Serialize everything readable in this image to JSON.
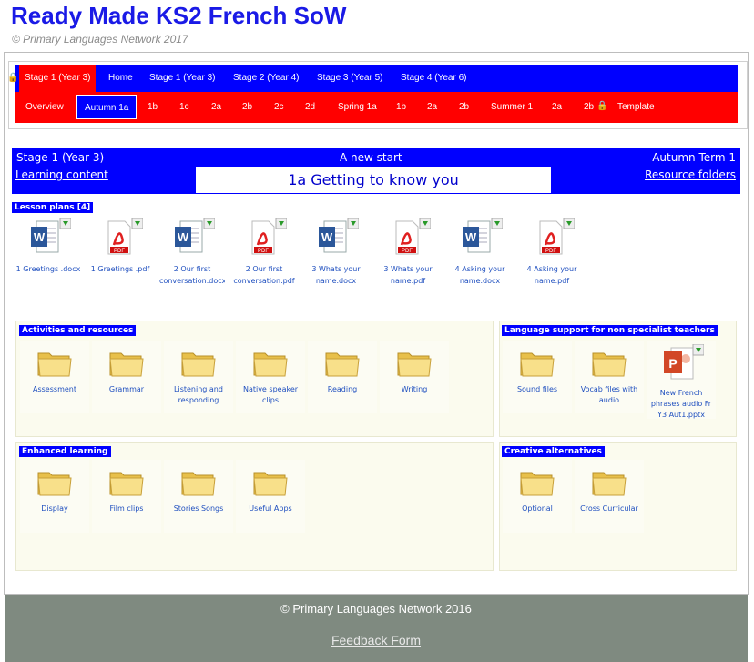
{
  "header": {
    "title": "Ready Made KS2 French SoW",
    "subtitle": "© Primary Languages Network 2017"
  },
  "nav_primary": [
    {
      "label": "Stage 1 (Year 3)",
      "current": true,
      "locked": true
    },
    {
      "label": "Home"
    },
    {
      "label": "Stage 1 (Year 3)"
    },
    {
      "label": "Stage 2 (Year 4)"
    },
    {
      "label": "Stage 3 (Year 5)"
    },
    {
      "label": "Stage 4 (Year 6)"
    }
  ],
  "nav_secondary": [
    {
      "label": "Overview"
    },
    {
      "label": "Autumn 1a",
      "current": true
    },
    {
      "label": "1b"
    },
    {
      "label": "1c"
    },
    {
      "label": "2a"
    },
    {
      "label": "2b"
    },
    {
      "label": "2c"
    },
    {
      "label": "2d"
    },
    {
      "label": "Spring 1a"
    },
    {
      "label": "1b"
    },
    {
      "label": "2a"
    },
    {
      "label": "2b"
    },
    {
      "label": "Summer 1"
    },
    {
      "label": "2a"
    },
    {
      "label": "2b"
    },
    {
      "label": "Template",
      "locked": true
    }
  ],
  "banner": {
    "stage": "Stage 1 (Year 3)",
    "theme": "A new start",
    "term": "Autumn Term 1",
    "learning_link": "Learning content",
    "resource_link": "Resource folders",
    "lesson_title": "1a Getting to know you"
  },
  "lesson_plans": {
    "label": "Lesson plans [4]",
    "files": [
      {
        "name": "1 Greetings .docx",
        "type": "word"
      },
      {
        "name": "1 Greetings .pdf",
        "type": "pdf"
      },
      {
        "name": "2 Our first conversation.docx",
        "type": "word"
      },
      {
        "name": "2 Our first conversation.pdf",
        "type": "pdf"
      },
      {
        "name": "3 Whats your name.docx",
        "type": "word"
      },
      {
        "name": "3 Whats your name.pdf",
        "type": "pdf"
      },
      {
        "name": "4 Asking your name.docx",
        "type": "word"
      },
      {
        "name": "4 Asking your name.pdf",
        "type": "pdf"
      }
    ]
  },
  "activities": {
    "label": "Activities and resources",
    "folders": [
      "Assessment",
      "Grammar",
      "Listening and responding",
      "Native speaker clips",
      "Reading",
      "Writing"
    ]
  },
  "language_support": {
    "label": "Language support for non specialist teachers",
    "items": [
      {
        "name": "Sound files",
        "type": "folder"
      },
      {
        "name": "Vocab files with audio",
        "type": "folder"
      },
      {
        "name": "New French phrases audio Fr Y3 Aut1.pptx",
        "type": "ppt"
      }
    ]
  },
  "enhanced": {
    "label": "Enhanced learning",
    "folders": [
      "Display",
      "Film clips",
      "Stories Songs",
      "Useful Apps"
    ]
  },
  "creative": {
    "label": "Creative alternatives",
    "folders": [
      "Optional",
      "Cross Curricular"
    ]
  },
  "footer": {
    "copyright": "© Primary Languages Network 2016",
    "feedback": "Feedback Form"
  },
  "colors": {
    "nav_blue": "#0000ff",
    "nav_red": "#ff0000",
    "title_blue": "#1a1ae6",
    "footer_grey": "#7f8a80",
    "panel_bg": "#fbfbee"
  }
}
